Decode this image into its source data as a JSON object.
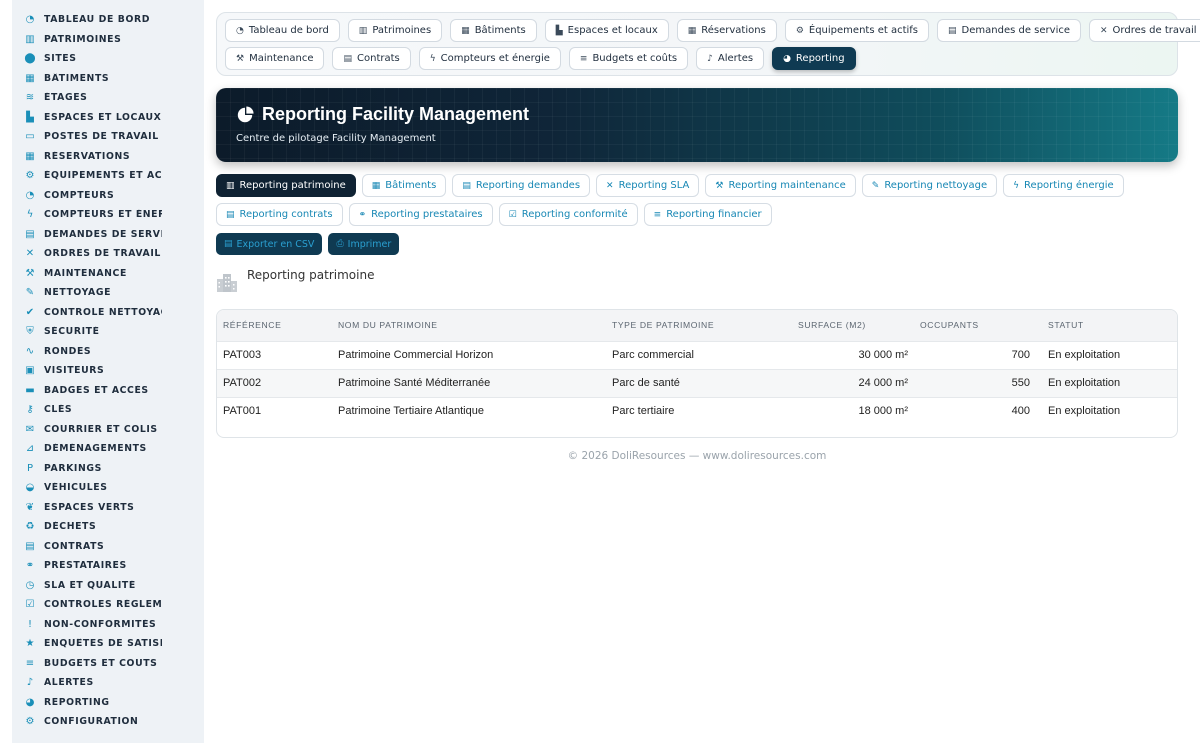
{
  "sidebar": {
    "items": [
      {
        "label": "TABLEAU DE BORD",
        "icon": "gauge-icon",
        "glyph": "◔"
      },
      {
        "label": "PATRIMOINES",
        "icon": "city-icon",
        "glyph": "▥"
      },
      {
        "label": "SITES",
        "icon": "map-pin-icon",
        "glyph": "⬤"
      },
      {
        "label": "BÂTIMENTS",
        "icon": "building-icon",
        "glyph": "▦"
      },
      {
        "label": "ÉTAGES",
        "icon": "layers-icon",
        "glyph": "≋"
      },
      {
        "label": "ESPACES ET LOCAUX",
        "icon": "door-icon",
        "glyph": "▙"
      },
      {
        "label": "POSTES DE TRAVAIL",
        "icon": "desktop-icon",
        "glyph": "▭"
      },
      {
        "label": "RÉSERVATIONS",
        "icon": "calendar-icon",
        "glyph": "▦"
      },
      {
        "label": "ÉQUIPEMENTS ET ACTIFS",
        "icon": "cogs-icon",
        "glyph": "⚙"
      },
      {
        "label": "COMPTEURS",
        "icon": "gauge-icon",
        "glyph": "◔"
      },
      {
        "label": "COMPTEURS ET ÉNERGIE",
        "icon": "bolt-icon",
        "glyph": "ϟ"
      },
      {
        "label": "DEMANDES DE SERVICE",
        "icon": "clipboard-icon",
        "glyph": "▤"
      },
      {
        "label": "ORDRES DE TRAVAIL",
        "icon": "tools-icon",
        "glyph": "✕"
      },
      {
        "label": "MAINTENANCE",
        "icon": "wrench-icon",
        "glyph": "⚒"
      },
      {
        "label": "NETTOYAGE",
        "icon": "broom-icon",
        "glyph": "✎"
      },
      {
        "label": "CONTRÔLE NETTOYAGE",
        "icon": "check-shield-icon",
        "glyph": "✔"
      },
      {
        "label": "SÉCURITÉ",
        "icon": "shield-icon",
        "glyph": "⛨"
      },
      {
        "label": "RONDES",
        "icon": "route-icon",
        "glyph": "∿"
      },
      {
        "label": "VISITEURS",
        "icon": "id-card-icon",
        "glyph": "▣"
      },
      {
        "label": "BADGES ET ACCÈS",
        "icon": "badge-icon",
        "glyph": "▬"
      },
      {
        "label": "CLÉS",
        "icon": "key-icon",
        "glyph": "⚷"
      },
      {
        "label": "COURRIER ET COLIS",
        "icon": "envelope-icon",
        "glyph": "✉"
      },
      {
        "label": "DÉMÉNAGEMENTS",
        "icon": "dolly-icon",
        "glyph": "⊿"
      },
      {
        "label": "PARKINGS",
        "icon": "parking-icon",
        "glyph": "P"
      },
      {
        "label": "VÉHICULES",
        "icon": "car-icon",
        "glyph": "◒"
      },
      {
        "label": "ESPACES VERTS",
        "icon": "leaf-icon",
        "glyph": "❦"
      },
      {
        "label": "DÉCHETS",
        "icon": "recycle-icon",
        "glyph": "♻"
      },
      {
        "label": "CONTRATS",
        "icon": "file-contract-icon",
        "glyph": "▤"
      },
      {
        "label": "PRESTATAIRES",
        "icon": "handshake-icon",
        "glyph": "⚭"
      },
      {
        "label": "SLA ET QUALITÉ",
        "icon": "stopwatch-icon",
        "glyph": "◷"
      },
      {
        "label": "CONTRÔLES RÉGLEMENTAIRES",
        "icon": "clipboard-check-icon",
        "glyph": "☑"
      },
      {
        "label": "NON-CONFORMITÉS",
        "icon": "exclamation-icon",
        "glyph": "!"
      },
      {
        "label": "ENQUÊTES DE SATISFACTION",
        "icon": "star-icon",
        "glyph": "★"
      },
      {
        "label": "BUDGETS ET COÛTS",
        "icon": "coins-icon",
        "glyph": "≡"
      },
      {
        "label": "ALERTES",
        "icon": "bell-icon",
        "glyph": "♪"
      },
      {
        "label": "REPORTING",
        "icon": "chart-pie-icon",
        "glyph": "◕"
      },
      {
        "label": "CONFIGURATION",
        "icon": "gear-icon",
        "glyph": "⚙"
      }
    ]
  },
  "topnav": {
    "row1": [
      {
        "label": "Tableau de bord",
        "icon": "gauge-icon",
        "glyph": "◔"
      },
      {
        "label": "Patrimoines",
        "icon": "city-icon",
        "glyph": "▥"
      },
      {
        "label": "Bâtiments",
        "icon": "building-icon",
        "glyph": "▦"
      },
      {
        "label": "Espaces et locaux",
        "icon": "door-icon",
        "glyph": "▙"
      },
      {
        "label": "Réservations",
        "icon": "calendar-icon",
        "glyph": "▦"
      },
      {
        "label": "Équipements et actifs",
        "icon": "cogs-icon",
        "glyph": "⚙"
      },
      {
        "label": "Demandes de service",
        "icon": "clipboard-icon",
        "glyph": "▤"
      },
      {
        "label": "Ordres de travail",
        "icon": "tools-icon",
        "glyph": "✕"
      }
    ],
    "row2": [
      {
        "label": "Maintenance",
        "icon": "wrench-icon",
        "glyph": "⚒"
      },
      {
        "label": "Contrats",
        "icon": "file-contract-icon",
        "glyph": "▤"
      },
      {
        "label": "Compteurs et énergie",
        "icon": "bolt-icon",
        "glyph": "ϟ"
      },
      {
        "label": "Budgets et coûts",
        "icon": "coins-icon",
        "glyph": "≡"
      },
      {
        "label": "Alertes",
        "icon": "bell-icon",
        "glyph": "♪"
      },
      {
        "label": "Reporting",
        "icon": "chart-pie-icon",
        "glyph": "◕",
        "active": true
      }
    ]
  },
  "banner": {
    "title": "Reporting Facility Management",
    "subtitle": "Centre de pilotage Facility Management"
  },
  "subtabs": {
    "row1": [
      {
        "label": "Reporting patrimoine",
        "icon": "city-icon",
        "glyph": "▥",
        "active": true
      },
      {
        "label": "Bâtiments",
        "icon": "building-icon",
        "glyph": "▦"
      },
      {
        "label": "Reporting demandes",
        "icon": "clipboard-icon",
        "glyph": "▤"
      },
      {
        "label": "Reporting SLA",
        "icon": "tools-icon",
        "glyph": "✕"
      },
      {
        "label": "Reporting maintenance",
        "icon": "wrench-icon",
        "glyph": "⚒"
      },
      {
        "label": "Reporting nettoyage",
        "icon": "broom-icon",
        "glyph": "✎"
      },
      {
        "label": "Reporting énergie",
        "icon": "bolt-icon",
        "glyph": "ϟ"
      }
    ],
    "row2": [
      {
        "label": "Reporting contrats",
        "icon": "file-contract-icon",
        "glyph": "▤"
      },
      {
        "label": "Reporting prestataires",
        "icon": "handshake-icon",
        "glyph": "⚭"
      },
      {
        "label": "Reporting conformité",
        "icon": "clipboard-check-icon",
        "glyph": "☑"
      },
      {
        "label": "Reporting financier",
        "icon": "coins-icon",
        "glyph": "≡"
      }
    ]
  },
  "actions": {
    "export_label": "Exporter en CSV",
    "print_label": "Imprimer"
  },
  "section": {
    "title": "Reporting patrimoine"
  },
  "table": {
    "columns": [
      "RÉFÉRENCE",
      "NOM DU PATRIMOINE",
      "TYPE DE PATRIMOINE",
      "SURFACE (M2)",
      "OCCUPANTS",
      "STATUT"
    ],
    "rows": [
      [
        "PAT003",
        "Patrimoine Commercial Horizon",
        "Parc commercial",
        "30 000 m²",
        "700",
        "En exploitation"
      ],
      [
        "PAT002",
        "Patrimoine Santé Méditerranée",
        "Parc de santé",
        "24 000 m²",
        "550",
        "En exploitation"
      ],
      [
        "PAT001",
        "Patrimoine Tertiaire Atlantique",
        "Parc tertiaire",
        "18 000 m²",
        "400",
        "En exploitation"
      ]
    ]
  },
  "footer": {
    "text": "© 2026 DoliResources — www.doliresources.com"
  },
  "colors": {
    "accent": "#1787b4",
    "active_nav": "#0f3a52",
    "banner_start": "#0c1b2a",
    "banner_end": "#157a86"
  }
}
